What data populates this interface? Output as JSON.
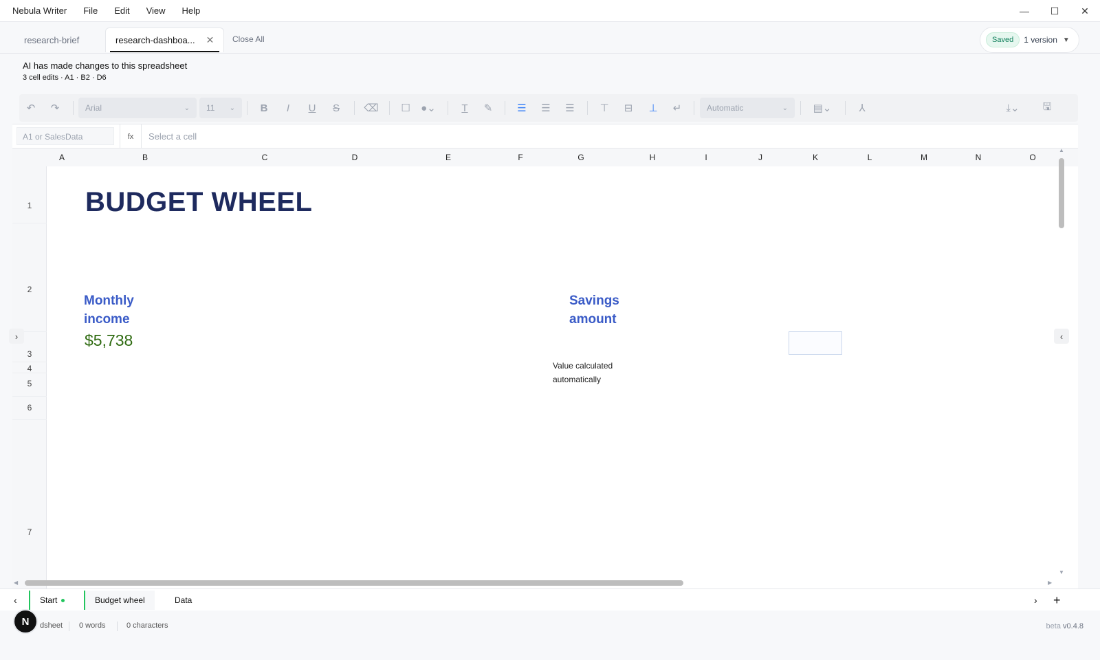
{
  "app": {
    "title": "Nebula Writer",
    "menu": [
      "File",
      "Edit",
      "View",
      "Help"
    ]
  },
  "tabs": {
    "items": [
      {
        "label": "research-brief",
        "active": false
      },
      {
        "label": "research-dashboa...",
        "active": true
      }
    ],
    "close_all": "Close All"
  },
  "save_status": {
    "badge": "Saved",
    "version": "1 version"
  },
  "ai_notice": {
    "title": "AI has made changes to this spreadsheet",
    "detail": "3 cell edits · A1 · B2 · D6"
  },
  "toolbar": {
    "font": "Arial",
    "size": "11",
    "number_format": "Automatic",
    "bold": "B",
    "italic": "I",
    "underline": "U",
    "strike": "S"
  },
  "formula_bar": {
    "name_placeholder": "A1 or SalesData",
    "fx": "fx",
    "value_placeholder": "Select a cell"
  },
  "grid": {
    "columns": [
      "A",
      "B",
      "C",
      "D",
      "E",
      "F",
      "G",
      "H",
      "I",
      "J",
      "K",
      "L",
      "M",
      "N",
      "O"
    ],
    "rows": [
      "1",
      "2",
      "3",
      "4",
      "5",
      "6",
      "7"
    ],
    "title": "BUDGET WHEEL",
    "income_label_1": "Monthly",
    "income_label_2": "income",
    "income_value": "$5,738",
    "savings_label_1": "Savings",
    "savings_label_2": "amount",
    "note_1": "Value calculated",
    "note_2": "automatically"
  },
  "sheets": {
    "items": [
      "Start",
      "Budget wheel",
      "Data"
    ],
    "active": "Budget wheel"
  },
  "status": {
    "partial": "dsheet",
    "words": "0 words",
    "characters": "0 characters",
    "logo": "N",
    "beta": "beta",
    "version": "v0.4.8"
  },
  "colors": {
    "title": "#1e2a5e",
    "label": "#3a5bc7",
    "money": "#2f6b11",
    "accent_green": "#22c55e"
  }
}
